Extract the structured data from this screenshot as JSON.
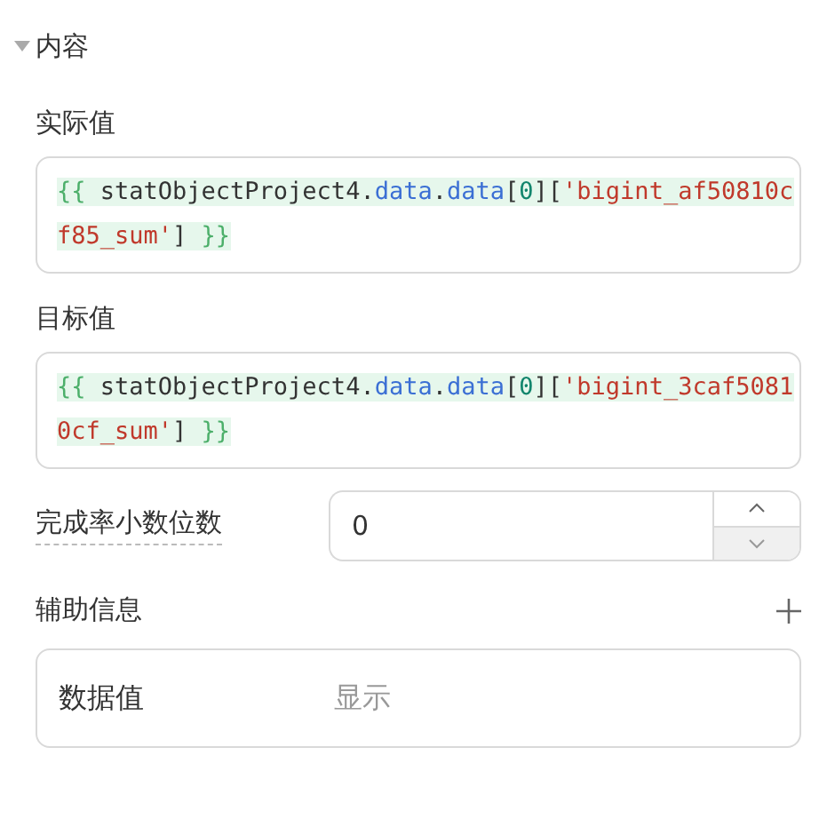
{
  "section": {
    "title": "内容",
    "expanded": true
  },
  "expressions": [
    {
      "label": "实际值",
      "tokens": [
        {
          "kind": "brace",
          "text": "{{"
        },
        {
          "kind": "ident",
          "text": " statObjectProject4."
        },
        {
          "kind": "prop",
          "text": "data"
        },
        {
          "kind": "ident",
          "text": "."
        },
        {
          "kind": "prop",
          "text": "data"
        },
        {
          "kind": "ident",
          "text": "["
        },
        {
          "kind": "number",
          "text": "0"
        },
        {
          "kind": "ident",
          "text": "]["
        },
        {
          "kind": "string",
          "text": "'bigint_af50810cf85_sum'"
        },
        {
          "kind": "ident",
          "text": "] "
        },
        {
          "kind": "brace",
          "text": "}}"
        }
      ]
    },
    {
      "label": "目标值",
      "tokens": [
        {
          "kind": "brace",
          "text": "{{"
        },
        {
          "kind": "ident",
          "text": " statObjectProject4."
        },
        {
          "kind": "prop",
          "text": "data"
        },
        {
          "kind": "ident",
          "text": "."
        },
        {
          "kind": "prop",
          "text": "data"
        },
        {
          "kind": "ident",
          "text": "["
        },
        {
          "kind": "number",
          "text": "0"
        },
        {
          "kind": "ident",
          "text": "]["
        },
        {
          "kind": "string",
          "text": "'bigint_3caf50810cf_sum'"
        },
        {
          "kind": "ident",
          "text": "] "
        },
        {
          "kind": "brace",
          "text": "}}"
        }
      ]
    }
  ],
  "decimals": {
    "label": "完成率小数位数",
    "value": "0"
  },
  "aux": {
    "title": "辅助信息",
    "items": [
      {
        "label": "数据值",
        "value": "显示"
      }
    ]
  }
}
